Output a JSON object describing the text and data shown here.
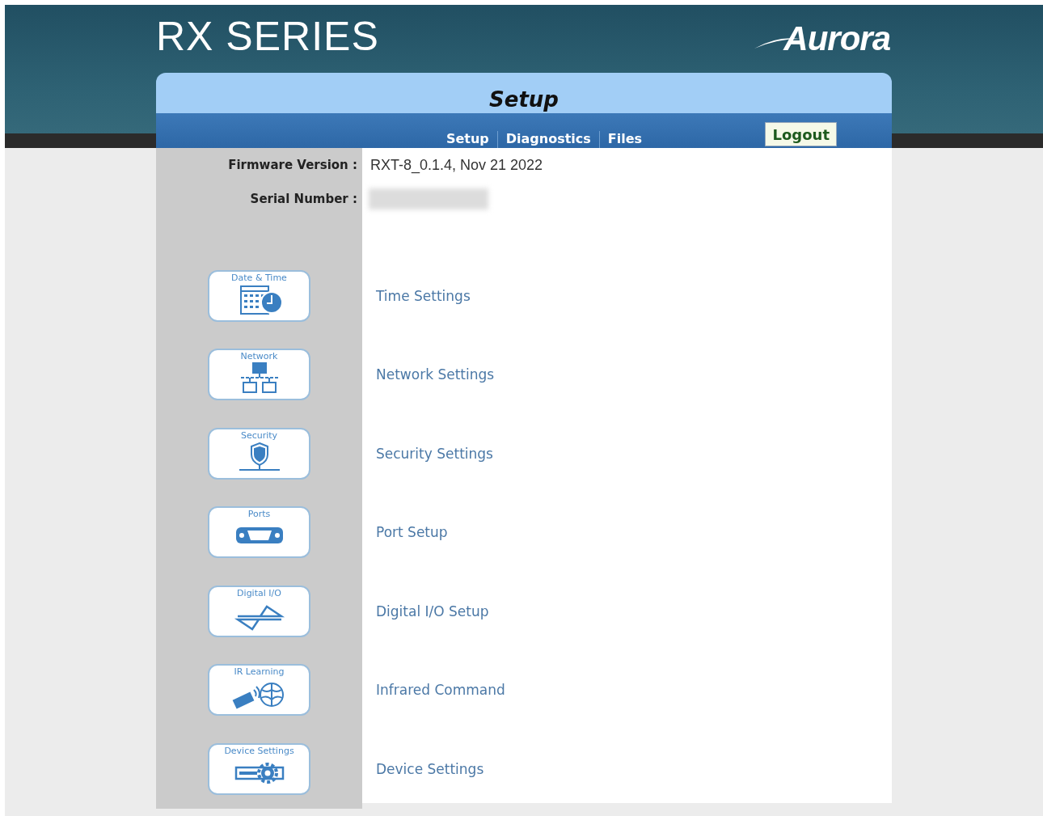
{
  "brand": {
    "product": "RX SERIES",
    "logo": "Aurora"
  },
  "panel": {
    "title": "Setup",
    "nav": [
      "Setup",
      "Diagnostics",
      "Files"
    ],
    "logout": "Logout"
  },
  "info": [
    {
      "label": "Firmware Version :",
      "value": "RXT-8_0.1.4, Nov 21 2022",
      "kind": "text"
    },
    {
      "label": "Serial Number :",
      "kind": "blurred"
    }
  ],
  "items": [
    {
      "tile": "Date & Time",
      "kind": "calendar",
      "link": "Time Settings"
    },
    {
      "tile": "Network",
      "kind": "network",
      "link": "Network Settings"
    },
    {
      "tile": "Security",
      "kind": "shield",
      "link": "Security Settings"
    },
    {
      "tile": "Ports",
      "kind": "port",
      "link": "Port Setup"
    },
    {
      "tile": "Digital I/O",
      "kind": "io",
      "link": "Digital I/O Setup"
    },
    {
      "tile": "IR Learning",
      "kind": "ir",
      "link": "Infrared Command"
    },
    {
      "tile": "Device Settings",
      "kind": "device",
      "link": "Device Settings"
    }
  ]
}
